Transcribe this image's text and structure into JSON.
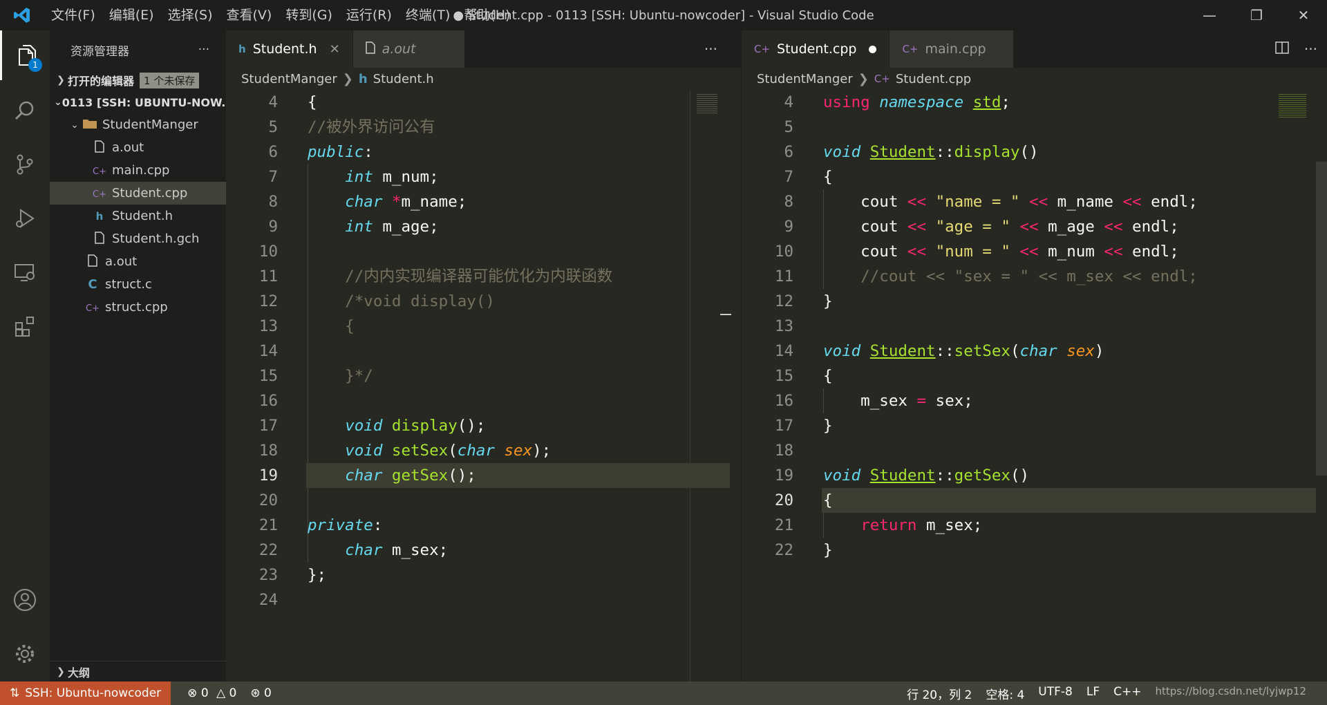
{
  "window": {
    "title": "● Student.cpp - 0113 [SSH: Ubuntu-nowcoder] - Visual Studio Code",
    "menu": [
      "文件(F)",
      "编辑(E)",
      "选择(S)",
      "查看(V)",
      "转到(G)",
      "运行(R)",
      "终端(T)",
      "帮助(H)"
    ]
  },
  "activity": {
    "badge": "1"
  },
  "sidebar": {
    "title": "资源管理器",
    "open_editors": "打开的编辑器",
    "unsaved": "1 个未保存",
    "workspace": "0113 [SSH: UBUNTU-NOW...",
    "folder": "StudentManger",
    "folder_files": [
      {
        "name": "a.out",
        "icon": "file-icon"
      },
      {
        "name": "main.cpp",
        "icon": "cpp-icon"
      },
      {
        "name": "Student.cpp",
        "icon": "cpp-icon"
      },
      {
        "name": "Student.h",
        "icon": "h-icon"
      },
      {
        "name": "Student.h.gch",
        "icon": "file-icon"
      }
    ],
    "root_files": [
      {
        "name": "a.out",
        "icon": "file-icon"
      },
      {
        "name": "struct.c",
        "icon": "c-icon"
      },
      {
        "name": "struct.cpp",
        "icon": "cpp-icon"
      }
    ],
    "outline": "大纲"
  },
  "left_editor": {
    "tabs": [
      "Student.h",
      "a.out"
    ],
    "breadcrumb": [
      "StudentManger",
      "Student.h"
    ],
    "lines": [
      {
        "n": "4",
        "t": "{"
      },
      {
        "n": "5",
        "t": "//被外界访问公有"
      },
      {
        "n": "6",
        "t": "public:"
      },
      {
        "n": "7",
        "t": "    int m_num;"
      },
      {
        "n": "8",
        "t": "    char *m_name;"
      },
      {
        "n": "9",
        "t": "    int m_age;"
      },
      {
        "n": "10",
        "t": ""
      },
      {
        "n": "11",
        "t": "    //内内实现编译器可能优化为内联函数"
      },
      {
        "n": "12",
        "t": "    /*void display()"
      },
      {
        "n": "13",
        "t": "    {"
      },
      {
        "n": "14",
        "t": ""
      },
      {
        "n": "15",
        "t": "    }*/"
      },
      {
        "n": "16",
        "t": ""
      },
      {
        "n": "17",
        "t": "    void display();"
      },
      {
        "n": "18",
        "t": "    void setSex(char sex);"
      },
      {
        "n": "19",
        "t": "    char getSex();"
      },
      {
        "n": "20",
        "t": ""
      },
      {
        "n": "21",
        "t": "private:"
      },
      {
        "n": "22",
        "t": "    char m_sex;"
      },
      {
        "n": "23",
        "t": "};"
      },
      {
        "n": "24",
        "t": ""
      }
    ]
  },
  "right_editor": {
    "tabs": [
      "Student.cpp",
      "main.cpp"
    ],
    "breadcrumb": [
      "StudentManger",
      "Student.cpp"
    ],
    "lines": [
      {
        "n": "4",
        "t": "using namespace std;"
      },
      {
        "n": "5",
        "t": ""
      },
      {
        "n": "6",
        "t": "void Student::display()"
      },
      {
        "n": "7",
        "t": "{"
      },
      {
        "n": "8",
        "t": "    cout << \"name = \" << m_name << endl;"
      },
      {
        "n": "9",
        "t": "    cout << \"age = \" << m_age << endl;"
      },
      {
        "n": "10",
        "t": "    cout << \"num = \" << m_num << endl;"
      },
      {
        "n": "11",
        "t": "    //cout << \"sex = \" << m_sex << endl;"
      },
      {
        "n": "12",
        "t": "}"
      },
      {
        "n": "13",
        "t": ""
      },
      {
        "n": "14",
        "t": "void Student::setSex(char sex)"
      },
      {
        "n": "15",
        "t": "{"
      },
      {
        "n": "16",
        "t": "    m_sex = sex;"
      },
      {
        "n": "17",
        "t": "}"
      },
      {
        "n": "18",
        "t": ""
      },
      {
        "n": "19",
        "t": "void Student::getSex()"
      },
      {
        "n": "20",
        "t": "{"
      },
      {
        "n": "21",
        "t": "    return m_sex;"
      },
      {
        "n": "22",
        "t": "}"
      }
    ]
  },
  "status": {
    "remote": "SSH: Ubuntu-nowcoder",
    "errors": "0",
    "warnings": "0",
    "ports": "0",
    "position": "行 20，列 2",
    "spaces": "空格: 4",
    "encoding": "UTF-8",
    "eol": "LF",
    "language": "C++",
    "watermark": "https://blog.csdn.net/lyjwp12"
  }
}
